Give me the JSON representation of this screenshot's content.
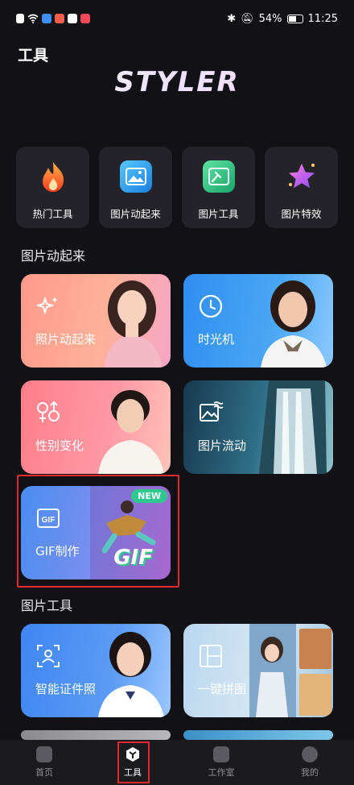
{
  "status": {
    "battery": "54%",
    "time": "11:25"
  },
  "header": {
    "title": "工具",
    "brand": "STYLER"
  },
  "categories": [
    {
      "label": "热门工具",
      "icon": "flame-icon"
    },
    {
      "label": "图片动起来",
      "icon": "image-animate-icon"
    },
    {
      "label": "图片工具",
      "icon": "image-tools-icon"
    },
    {
      "label": "图片特效",
      "icon": "star-effects-icon"
    }
  ],
  "sections": {
    "animate": {
      "title": "图片动起来",
      "cards": [
        {
          "label": "照片动起来",
          "icon": "sparkle-icon"
        },
        {
          "label": "时光机",
          "icon": "clock-icon"
        },
        {
          "label": "性别变化",
          "icon": "gender-icon"
        },
        {
          "label": "图片流动",
          "icon": "image-flow-icon"
        },
        {
          "label": "GIF制作",
          "icon": "gif-icon",
          "badge": "NEW",
          "art_text": "GIF"
        }
      ]
    },
    "tools": {
      "title": "图片工具",
      "cards": [
        {
          "label": "智能证件照",
          "icon": "id-photo-icon"
        },
        {
          "label": "一键拼图",
          "icon": "collage-icon"
        }
      ]
    }
  },
  "tabbar": [
    {
      "label": "首页",
      "icon": "home-icon",
      "active": false
    },
    {
      "label": "工具",
      "icon": "tools-tab-icon",
      "active": true
    },
    {
      "label": "工作室",
      "icon": "studio-icon",
      "active": false
    },
    {
      "label": "我的",
      "icon": "profile-icon",
      "active": false
    }
  ],
  "colors": {
    "highlight": "#e22a2a",
    "badge": "#2fc88f"
  }
}
